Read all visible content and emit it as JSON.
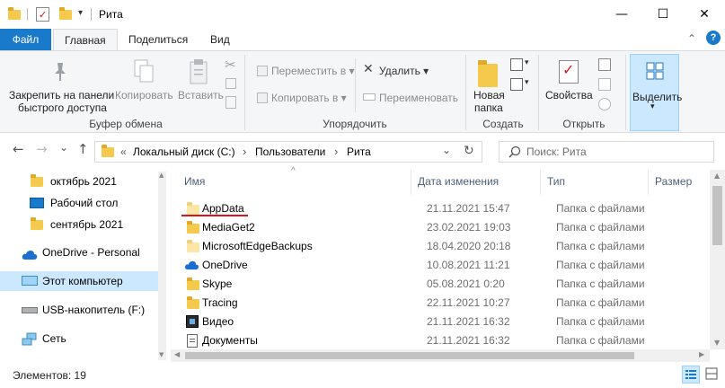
{
  "window": {
    "title": "Рита",
    "minimize_glyph": "—",
    "maximize_glyph": "☐",
    "close_glyph": "✕"
  },
  "ribbon_tabs": {
    "file": "Файл",
    "home": "Главная",
    "share": "Поделиться",
    "view": "Вид",
    "collapse_glyph": "⌃",
    "help_glyph": "?"
  },
  "ribbon": {
    "clipboard": {
      "pin_line1": "Закрепить на панели",
      "pin_line2": "быстрого доступа",
      "copy": "Копировать",
      "paste": "Вставить",
      "group": "Буфер обмена"
    },
    "organize": {
      "move_to": "Переместить в ▾",
      "copy_to": "Копировать в ▾",
      "delete": "Удалить ▾",
      "rename": "Переименовать",
      "group": "Упорядочить"
    },
    "new": {
      "new_folder_line1": "Новая",
      "new_folder_line2": "папка",
      "group": "Создать"
    },
    "open": {
      "properties": "Свойства",
      "group": "Открыть"
    },
    "select": {
      "select": "Выделить",
      "caret": "▾"
    }
  },
  "address": {
    "back": "←",
    "forward": "→",
    "recent": "⌄",
    "up": "↑",
    "crumb_prefix": "«",
    "crumbs": [
      "Локальный диск (C:)",
      "Пользователи",
      "Рита"
    ],
    "sep": "›",
    "dropdown": "⌄",
    "refresh": "↻",
    "search_placeholder": "Поиск: Рита"
  },
  "nav": {
    "items": [
      {
        "label": "октябрь 2021"
      },
      {
        "label": "Рабочий стол"
      },
      {
        "label": "сентябрь 2021"
      },
      {
        "label": "OneDrive - Personal"
      },
      {
        "label": "Этот компьютер"
      },
      {
        "label": "USB-накопитель (F:)"
      },
      {
        "label": "Сеть"
      }
    ]
  },
  "columns": {
    "name": "Имя",
    "date": "Дата изменения",
    "type": "Тип",
    "size": "Размер",
    "sort_glyph": "^"
  },
  "files": [
    {
      "name": "AppData",
      "date": "21.11.2021 15:47",
      "type": "Папка с файлами"
    },
    {
      "name": "MediaGet2",
      "date": "23.02.2021 19:03",
      "type": "Папка с файлами"
    },
    {
      "name": "MicrosoftEdgeBackups",
      "date": "18.04.2020 20:18",
      "type": "Папка с файлами"
    },
    {
      "name": "OneDrive",
      "date": "10.08.2021 11:21",
      "type": "Папка с файлами"
    },
    {
      "name": "Skype",
      "date": "05.08.2021 0:20",
      "type": "Папка с файлами"
    },
    {
      "name": "Tracing",
      "date": "22.11.2021 10:27",
      "type": "Папка с файлами"
    },
    {
      "name": "Видео",
      "date": "21.11.2021 16:32",
      "type": "Папка с файлами"
    },
    {
      "name": "Документы",
      "date": "21.11.2021 16:32",
      "type": "Папка с файлами"
    }
  ],
  "status": {
    "count": "Элементов: 19"
  },
  "colors": {
    "file_tab": "#1979ca",
    "selected_nav": "#cce8ff",
    "underline": "#d8141c"
  }
}
